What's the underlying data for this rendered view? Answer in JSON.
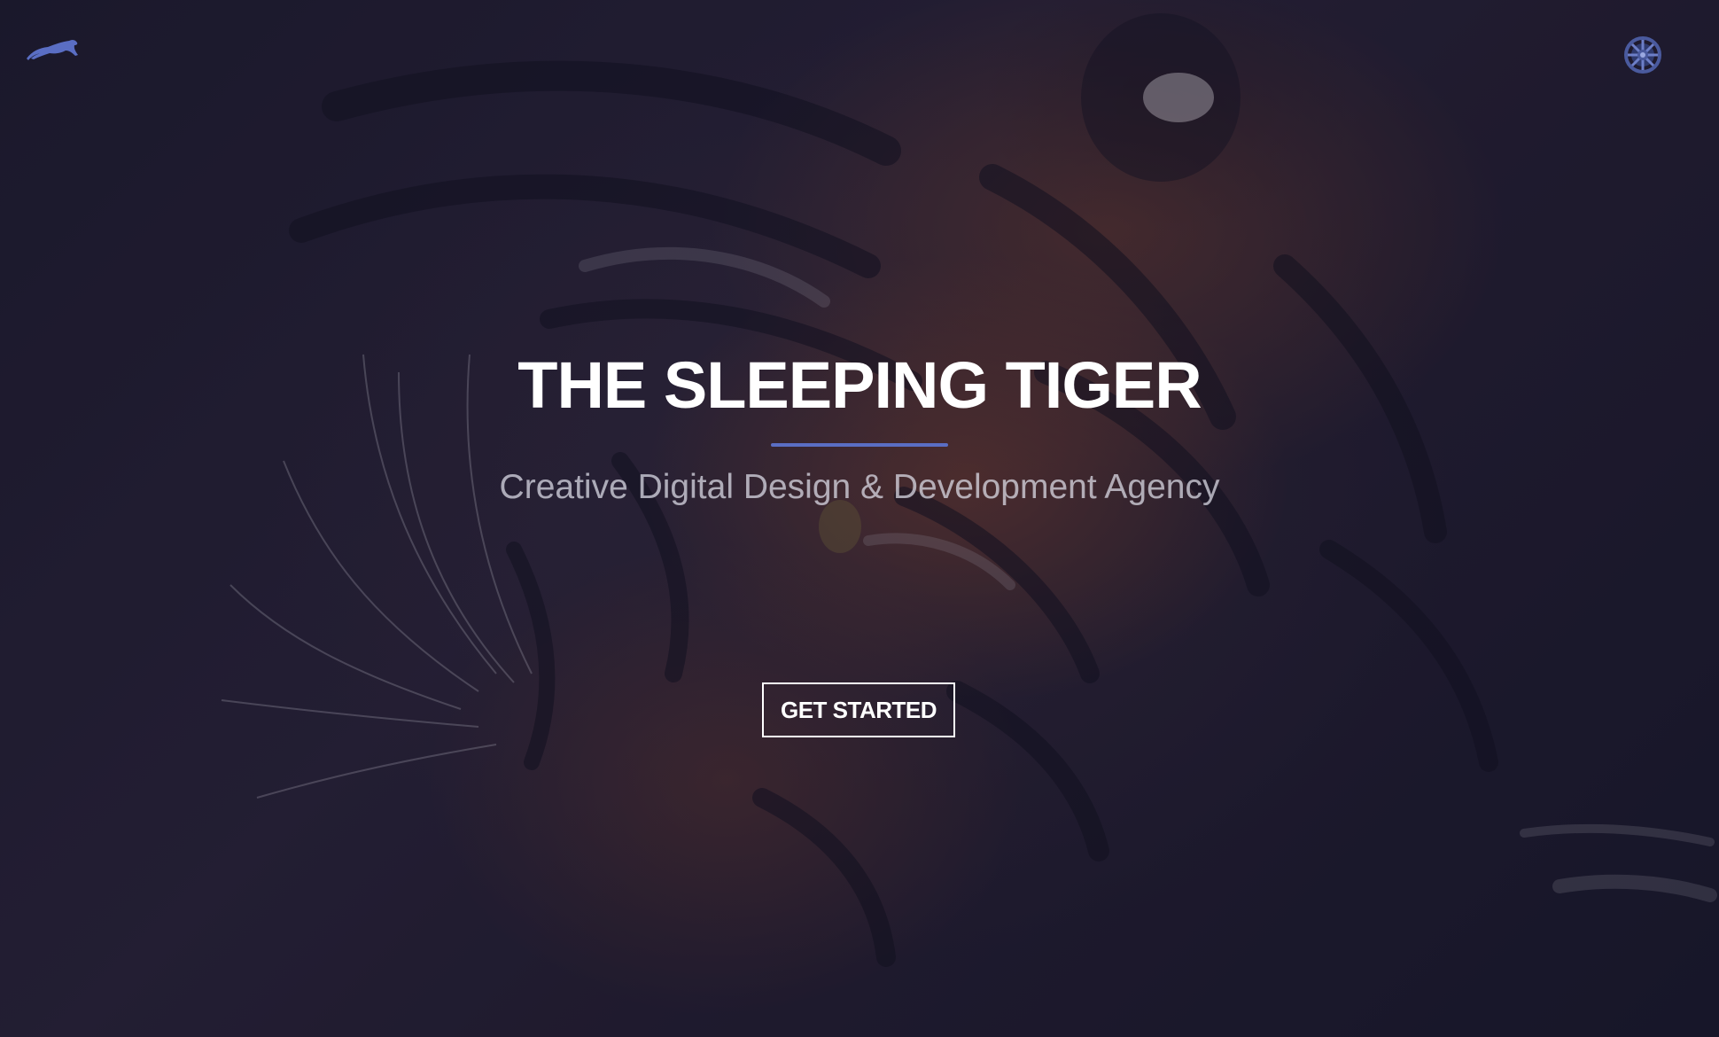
{
  "header": {
    "logo_icon": "leaping-panther-icon",
    "menu_icon": "galactic-empire-emblem-icon",
    "accent_color": "#5a6ec4"
  },
  "hero": {
    "title": "THE SLEEPING TIGER",
    "subtitle": "Creative Digital Design & Development Agency",
    "cta_label": "GET STARTED",
    "background_image": "sleeping-tiger-photo"
  }
}
